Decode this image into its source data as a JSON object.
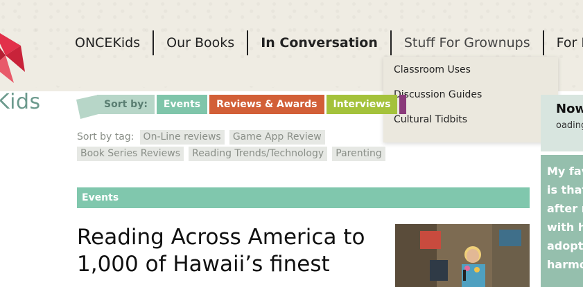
{
  "brand": {
    "logo_text": "Kids",
    "colors": {
      "teal": "#80c7ad",
      "red": "#e2304a",
      "paper": "#efece3"
    }
  },
  "nav": {
    "items": [
      {
        "label": "ONCEKids"
      },
      {
        "label": "Our Books"
      },
      {
        "label": "In Conversation"
      },
      {
        "label": "Stuff For Grownups"
      },
      {
        "label": "For Kid"
      }
    ]
  },
  "dropdown": {
    "items": [
      {
        "label": "Classroom Uses"
      },
      {
        "label": "Discussion Guides"
      },
      {
        "label": "Cultural Tidbits"
      }
    ]
  },
  "sort": {
    "label": "Sort by:",
    "buttons": [
      {
        "label": "Events",
        "color": "#7fc5aa"
      },
      {
        "label": "Reviews & Awards",
        "color": "#d25f37"
      },
      {
        "label": "Interviews",
        "color": "#a4c23b"
      }
    ]
  },
  "tags": {
    "label": "Sort by tag:",
    "items": [
      {
        "label": "On-Line reviews"
      },
      {
        "label": "Game App Review"
      },
      {
        "label": "Book Series Reviews"
      },
      {
        "label": "Reading Trends/Technology"
      },
      {
        "label": "Parenting"
      }
    ]
  },
  "section": {
    "title": "Events"
  },
  "article": {
    "title_line1": "Reading Across America to",
    "title_line2": "1,000 of Hawaii’s finest"
  },
  "sidebar": {
    "heading": "Now",
    "loading": "oading",
    "quote_lines": [
      "My fav",
      "is that",
      "after m",
      "with he",
      "adopte",
      "harmo"
    ]
  }
}
